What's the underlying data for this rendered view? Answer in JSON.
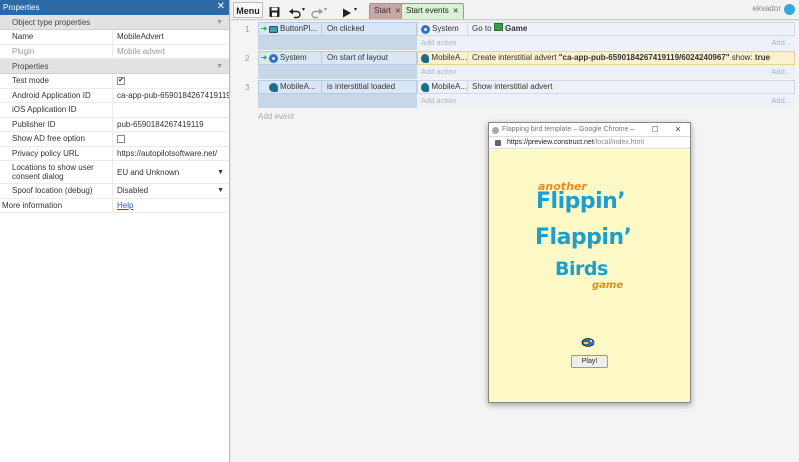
{
  "properties": {
    "title": "Properties",
    "close": "✕",
    "sections": {
      "object_type": "Object type properties",
      "properties": "Properties"
    },
    "object_rows": [
      {
        "name": "Name",
        "value": "MobileAdvert"
      },
      {
        "name": "Plugin",
        "value": "Mobile advert"
      }
    ],
    "rows": [
      {
        "name": "Test mode",
        "checked": true
      },
      {
        "name": "Android Application ID",
        "value": "ca-app-pub-6590184267419119~6"
      },
      {
        "name": "iOS Application ID",
        "value": ""
      },
      {
        "name": "Publisher ID",
        "value": "pub-6590184267419119"
      },
      {
        "name": "Show AD free option",
        "checked": false
      },
      {
        "name": "Privacy policy URL",
        "value": "https://autopilotsoftware.net/"
      },
      {
        "name": "Locations to show user consent dialog",
        "value": "EU and Unknown"
      },
      {
        "name": "Spoof location (debug)",
        "value": "Disabled"
      }
    ],
    "more": {
      "name": "More information",
      "value": "Help"
    }
  },
  "toolbar": {
    "menu": "Menu",
    "tabs": [
      "Start",
      "Start events"
    ],
    "user": "ekvador"
  },
  "events": [
    {
      "num": "1",
      "cond_object": "ButtonPl...",
      "cond_name": "On clicked",
      "act_object": "System",
      "act_name_prefix": "Go to",
      "act_name_bold": "Game",
      "act_name_suffix": ""
    },
    {
      "num": "2",
      "cond_object": "System",
      "cond_name": "On start of layout",
      "act_object": "MobileA...",
      "act_name_prefix": "Create interstitial advert",
      "act_name_bold": "\"ca-app-pub-6590184267419119/6024240967\"",
      "act_name_suffix": "show:",
      "act_name_bold2": "true"
    },
    {
      "num": "3",
      "cond_object": "MobileA...",
      "cond_name": "is interstitial loaded",
      "act_object": "MobileA...",
      "act_name_prefix": "Show interstitial advert",
      "act_name_bold": "",
      "act_name_suffix": ""
    }
  ],
  "add_action": "Add action",
  "add_right": "Add...",
  "add_event": "Add event",
  "browser": {
    "title": "Flapping bird template – Google Chrome",
    "url_host": "https://preview.construct.net",
    "url_path": "/local/index.html",
    "game": {
      "another": "another",
      "flippin": "Flippin’",
      "flappin": "Flappin’",
      "birds": "Birds",
      "game": "game",
      "play": "Play!"
    }
  }
}
